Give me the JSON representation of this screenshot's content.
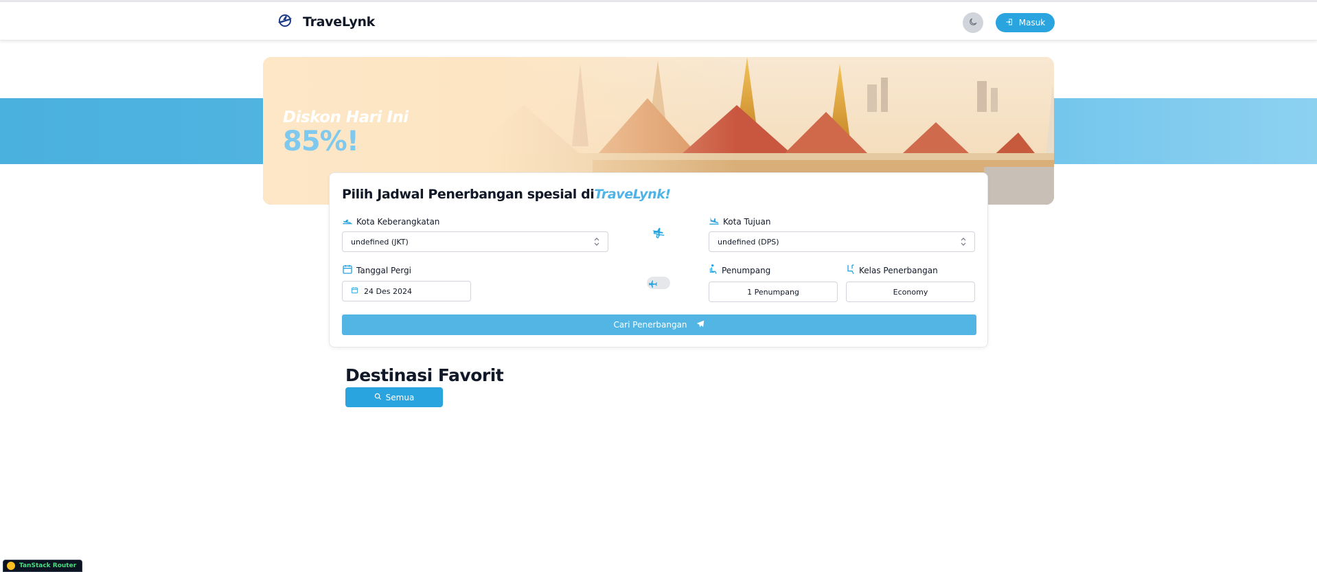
{
  "navbar": {
    "brand_name": "TraveLynk",
    "login_label": "Masuk"
  },
  "hero": {
    "promo_title": "Diskon Hari Ini",
    "promo_value": "85%!"
  },
  "search_card": {
    "title_prefix": "Pilih Jadwal Penerbangan spesial di",
    "title_accent": "TraveLynk!",
    "departure_label": "Kota Keberangkatan",
    "departure_value": "undefined (JKT)",
    "destination_label": "Kota Tujuan",
    "destination_value": "undefined (DPS)",
    "date_label": "Tanggal Pergi",
    "date_value": "24 Des 2024",
    "passenger_label": "Penumpang",
    "passenger_value": "1 Penumpang",
    "class_label": "Kelas Penerbangan",
    "class_value": "Economy",
    "search_button": "Cari Penerbangan",
    "round_trip_enabled": false
  },
  "favorites": {
    "title": "Destinasi Favorit",
    "all_button": "Semua"
  },
  "devtools": {
    "label": "TanStack Router"
  },
  "colors": {
    "primary": "#2aa4df",
    "search_button": "#52b5e4",
    "accent_text": "#4fb3e6",
    "hero_bg": "#fde5c3"
  },
  "icons": {
    "brand": "plane-globe-icon",
    "theme": "moon-icon",
    "login": "login-icon",
    "departure": "plane-departure-icon",
    "arrival": "plane-arrival-icon",
    "swap": "swap-planes-icon",
    "calendar": "calendar-icon",
    "passenger": "seat-person-icon",
    "class": "seat-icon",
    "search": "search-icon",
    "search_plane": "plane-icon"
  }
}
